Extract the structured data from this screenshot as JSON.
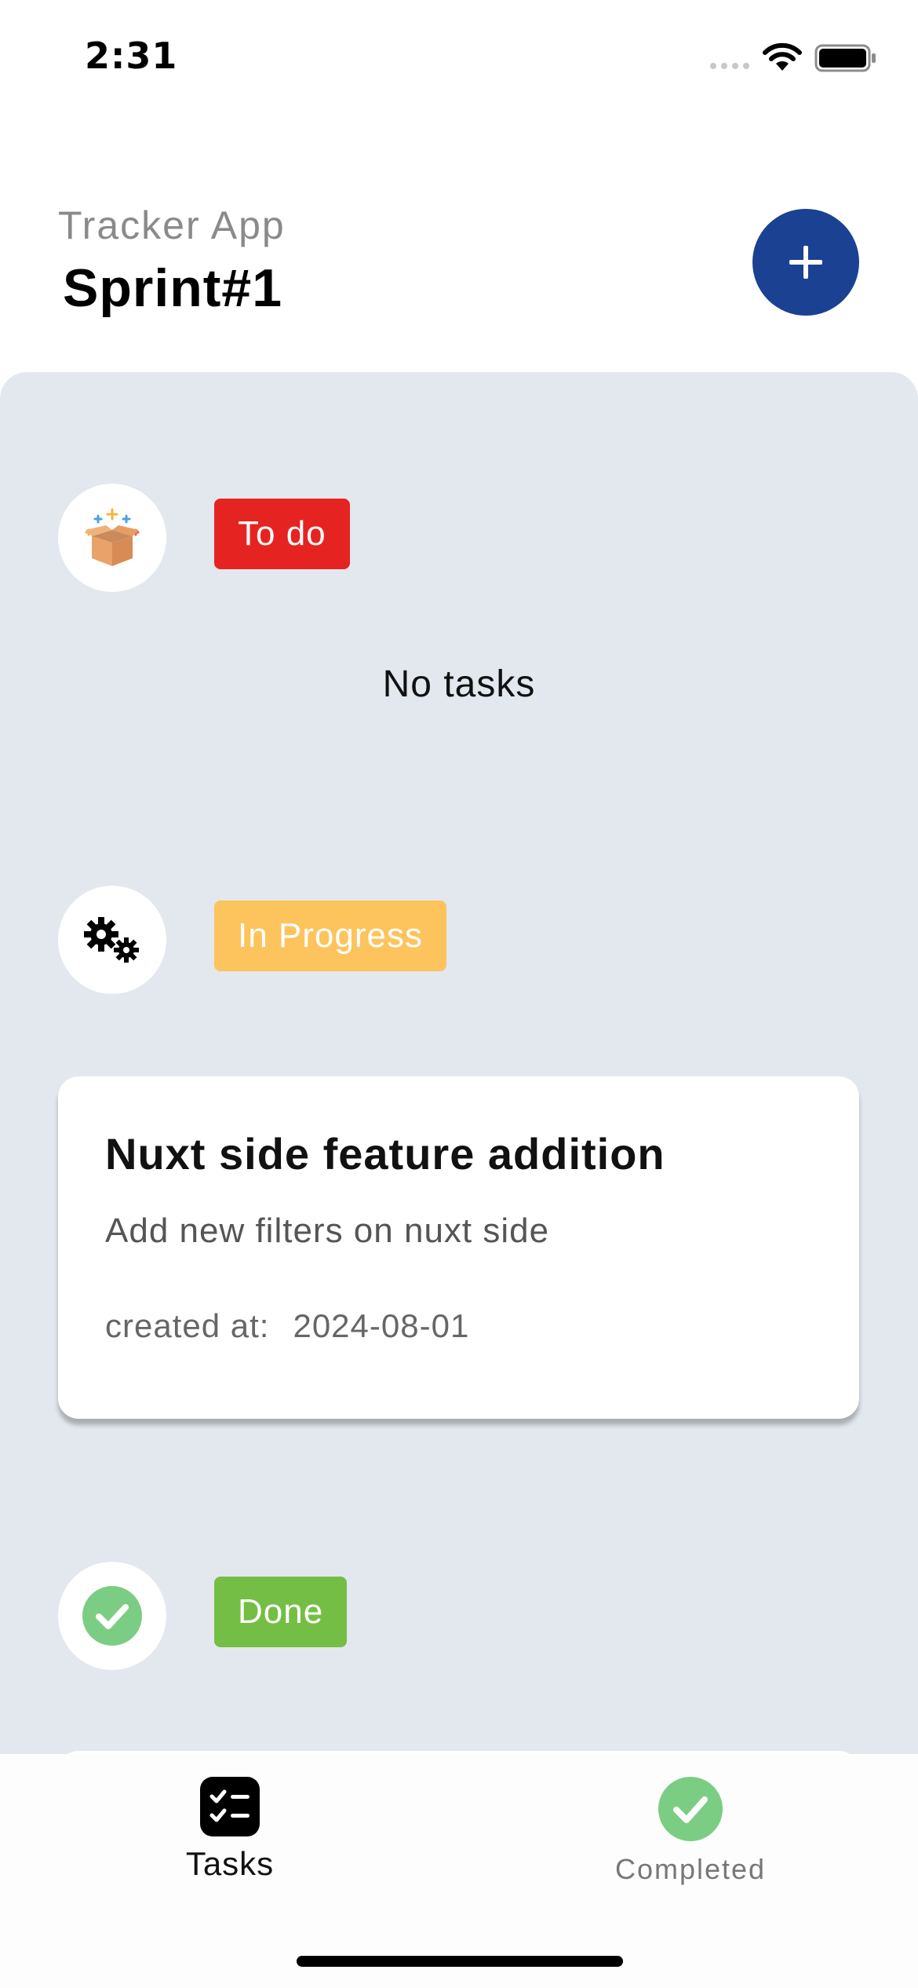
{
  "status_bar": {
    "time": "2:31"
  },
  "header": {
    "subtitle": "Tracker App",
    "title": "Sprint#1",
    "add_icon": "plus-icon"
  },
  "sections": [
    {
      "label": "To do",
      "color": "#e52421",
      "icon": "gift-box-icon",
      "empty_text": "No tasks"
    },
    {
      "label": "In Progress",
      "color": "#fdc35c",
      "icon": "gears-icon",
      "tasks": [
        {
          "title": "Nuxt side feature addition",
          "description": "Add new filters on nuxt side",
          "created_label": "created at:",
          "created_date": "2024-08-01"
        }
      ]
    },
    {
      "label": "Done",
      "color": "#75be45",
      "icon": "check-circle-icon"
    }
  ],
  "tab_bar": {
    "items": [
      {
        "label": "Tasks",
        "icon": "checklist-icon",
        "active": true
      },
      {
        "label": "Completed",
        "icon": "check-circle-icon",
        "active": false
      }
    ]
  },
  "colors": {
    "accent": "#1a4192",
    "board_background": "#e3e8ee",
    "success": "#7ccd84"
  }
}
